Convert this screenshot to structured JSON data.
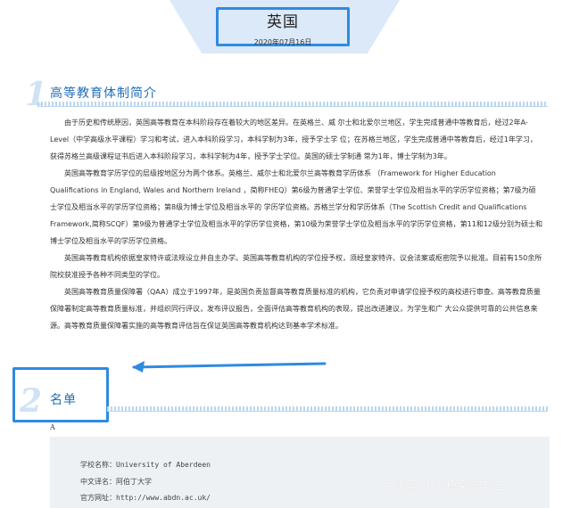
{
  "header": {
    "title": "英国",
    "date": "2020年07月16日"
  },
  "section1": {
    "number": "1",
    "title": "高等教育体制简介",
    "paragraphs": [
      "由于历史和传统原因，英国高等教育在本科阶段存在着较大的地区差异。在英格兰、威 尔士和北爱尔兰地区，学生完成普通中等教育后，经过2年A-Level（中学高级水平课程）学习和考试，进入本科阶段学习，本科学制为3年，授予学士学 位；在苏格兰地区，学生完成普通中等教育后，经过1年学习，获得苏格兰高级课程证书后进入本科阶段学习，本科学制为4年，授予学士学位。英国的硕士学制通 常为1年，博士学制为3年。",
      "英国高等教育学历学位的层级按地区分为两个体系。英格兰、威尔士和北爱尔兰高等教育学历体系 （Framework for Higher Education Qualifications in England, Wales and Northern Ireland ，简称FHEQ）第6级为普通学士学位、荣誉学士学位及相当水平的学历学位资格；第7级为硕士学位及相当水平的学历学位资格；第8级为博士学位及相当水平的 学历学位资格。苏格兰学分和学历体系（The Scottish Credit and Qualifications Framework,简称SCQF）第9级为普通学士学位及相当水平的学历学位资格，第10级为荣誉学士学位及相当水平的学历学位资格，第11和12级分别为硕士和博士学位及相当水平的学历学位资格。",
      "英国高等教育机构依据皇家特许或法规设立并自主办学。英国高等教育机构的学位授予权，须经皇家特许、议会法案或枢密院予以批准。目前有150余所院校获准授予各种不同类型的学位。",
      "英国高等教育质量保障署（QAA）成立于1997年，是英国负责监督高等教育质量标准的机构，它负责对申请学位授予权的高校进行审查。高等教育质量保障署制定高等教育质量标准，并组织同行评议，发布评议报告，全面评估高等教育机构的表现，提出改进建议，为学生和广 大公众提供可靠的公共信息来源。高等教育质量保障署实施的高等教育评估旨在保证英国高等教育机构达到基本学术标准。"
    ]
  },
  "section2": {
    "number": "2",
    "title": "名单",
    "group_letter": "A",
    "entry": {
      "name_label": "学校名称：University of Aberdeen",
      "cn_label": "中文译名：阿伯丁大学",
      "url_label": "官方网址：http://www.abdn.ac.uk/"
    }
  },
  "watermark": "百家号/上海稳朵商务咨",
  "colors": {
    "accent": "#2f8ae0",
    "title_blue": "#1f6fb7",
    "banner": "#dbe9f8",
    "number_light": "#cfe2f6",
    "card_bg": "#eef1f4"
  }
}
